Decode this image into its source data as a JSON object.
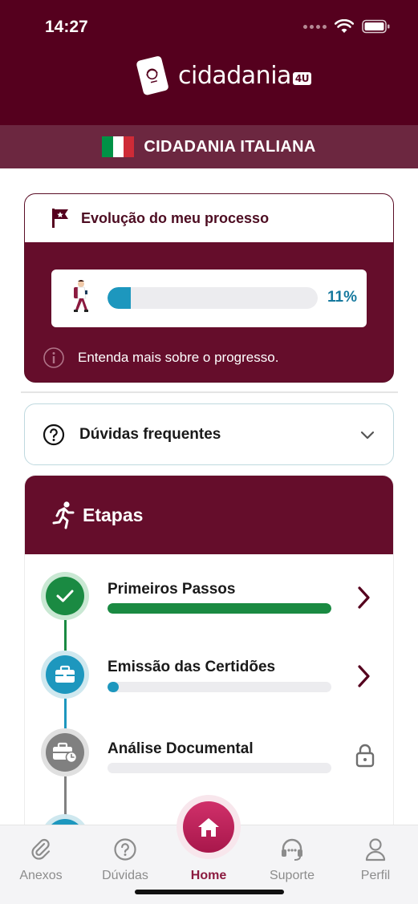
{
  "status_bar": {
    "time": "14:27"
  },
  "brand": {
    "name": "cidadania",
    "badge": "4U"
  },
  "country": {
    "title": "CIDADANIA ITALIANA",
    "flag_colors": [
      "#009246",
      "#ffffff",
      "#ce2b37"
    ]
  },
  "progress": {
    "title": "Evolução do meu processo",
    "percent_label": "11%",
    "percent_value": 0.11,
    "info_text": "Entenda mais sobre o progresso."
  },
  "faq": {
    "title": "Dúvidas frequentes"
  },
  "etapas": {
    "title": "Etapas",
    "steps": [
      {
        "label": "Primeiros Passos",
        "progress": 1.0,
        "status": "complete",
        "color": "#1a8a42",
        "icon": "check-icon",
        "action": "chevron-right-icon"
      },
      {
        "label": "Emissão das Certidões",
        "progress": 0.05,
        "status": "in-progress",
        "color": "#1d97be",
        "icon": "briefcase-icon",
        "action": "chevron-right-icon"
      },
      {
        "label": "Análise Documental",
        "progress": 0.0,
        "status": "locked",
        "color": "#808080",
        "icon": "briefcase-clock-icon",
        "action": "lock-icon"
      }
    ]
  },
  "colors": {
    "brand": "#55001e",
    "brand_dark": "#650d2b",
    "accent_pink": "#c0245c",
    "progress_blue": "#1d97be",
    "success_green": "#1a8a42"
  },
  "bottom_nav": {
    "items": [
      {
        "label": "Anexos",
        "icon": "paperclip-icon",
        "active": false
      },
      {
        "label": "Dúvidas",
        "icon": "question-circle-icon",
        "active": false
      },
      {
        "label": "Home",
        "icon": "home-icon",
        "active": true
      },
      {
        "label": "Suporte",
        "icon": "headset-icon",
        "active": false
      },
      {
        "label": "Perfil",
        "icon": "person-icon",
        "active": false
      }
    ]
  }
}
